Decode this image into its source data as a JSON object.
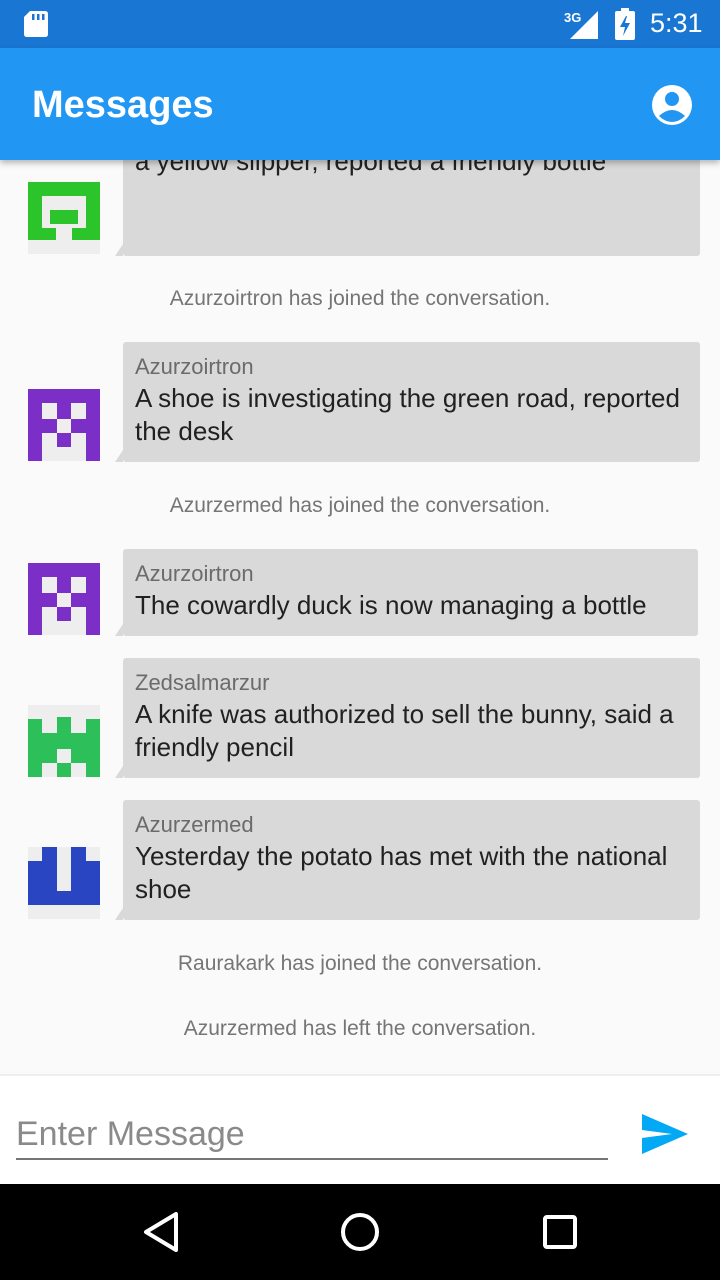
{
  "status_bar": {
    "network": "3G",
    "time": "5:31",
    "icons": [
      "sd-card-icon",
      "signal-icon",
      "battery-charging-icon"
    ]
  },
  "app_bar": {
    "title": "Messages",
    "icons": [
      "account-icon"
    ]
  },
  "colors": {
    "status_bar": "#1976d2",
    "app_bar": "#2196f3",
    "bubble": "#d9d9d9",
    "send_accent": "#03a9f4",
    "avatar_green_light": "#2bc42b",
    "avatar_purple": "#7b2fc6",
    "avatar_green": "#2dbf5a",
    "avatar_blue": "#2a45c2"
  },
  "messages": [
    {
      "type": "chat",
      "sender": "",
      "avatar": "green-pixel-avatar",
      "text": "Last Thursday morning the solid table became a yellow slipper, reported a friendly bottle"
    },
    {
      "type": "system",
      "text": "Azurzoirtron has joined the conversation."
    },
    {
      "type": "chat",
      "sender": "Azurzoirtron",
      "avatar": "purple-pixel-avatar",
      "text": "A shoe is investigating the green road, reported the desk"
    },
    {
      "type": "system",
      "text": "Azurzermed has joined the conversation."
    },
    {
      "type": "chat",
      "sender": "Azurzoirtron",
      "avatar": "purple-pixel-avatar",
      "text": "The cowardly duck is now managing a bottle"
    },
    {
      "type": "chat",
      "sender": "Zedsalmarzur",
      "avatar": "green-pixel-avatar",
      "text": "A knife was authorized to sell the bunny, said a friendly pencil"
    },
    {
      "type": "chat",
      "sender": "Azurzermed",
      "avatar": "blue-pixel-avatar",
      "text": "Yesterday the potato has met with the national shoe"
    },
    {
      "type": "system",
      "text": "Raurakark has joined the conversation."
    },
    {
      "type": "system",
      "text": "Azurzermed has left the conversation."
    }
  ],
  "composer": {
    "placeholder": "Enter Message",
    "value": "",
    "send_icon": "send-icon"
  },
  "nav_bar": {
    "icons": [
      "back-icon",
      "home-icon",
      "recents-icon"
    ]
  }
}
